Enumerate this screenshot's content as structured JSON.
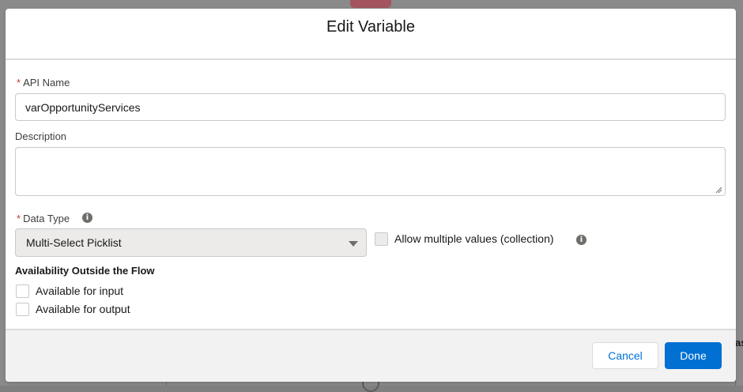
{
  "background": {
    "partial_text": "as"
  },
  "modal": {
    "title": "Edit Variable",
    "api_name": {
      "required_mark": "*",
      "label": "API Name",
      "value": "varOpportunityServices"
    },
    "description": {
      "label": "Description",
      "value": ""
    },
    "data_type": {
      "required_mark": "*",
      "label": "Data Type",
      "info_icon": "info-icon",
      "selected": "Multi-Select Picklist"
    },
    "allow_multiple": {
      "label": "Allow multiple values (collection)",
      "checked": false,
      "disabled": true,
      "info_icon": "info-icon"
    },
    "availability": {
      "title": "Availability Outside the Flow",
      "options": [
        {
          "label": "Available for input",
          "checked": false
        },
        {
          "label": "Available for output",
          "checked": false
        }
      ]
    },
    "footer": {
      "cancel_label": "Cancel",
      "done_label": "Done"
    }
  },
  "colors": {
    "brand": "#0070d2",
    "required": "#c23934",
    "overlay": "#8a8a8a"
  }
}
